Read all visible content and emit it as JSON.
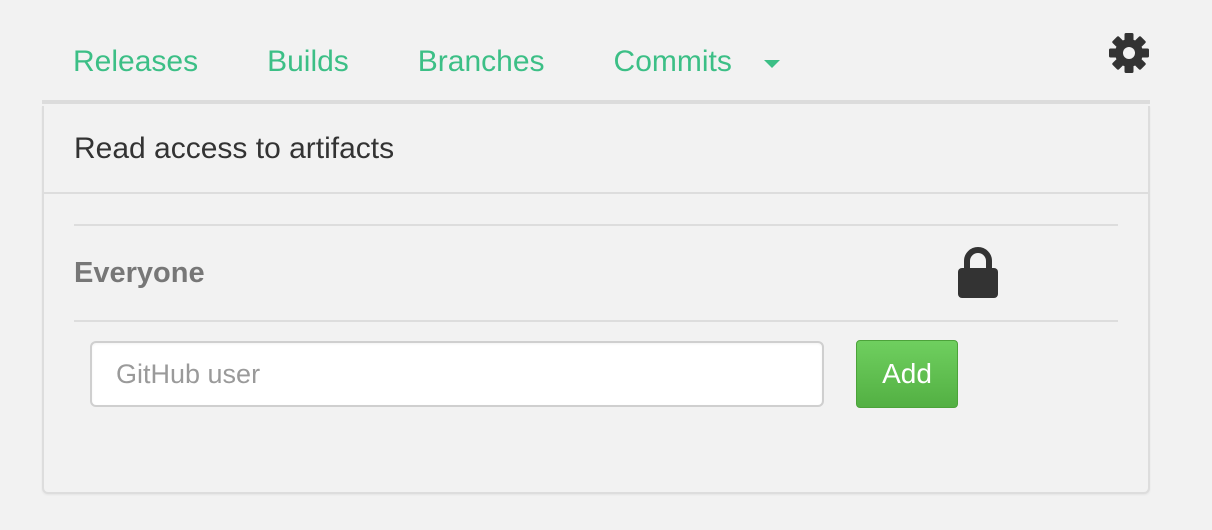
{
  "nav": {
    "tabs": [
      {
        "label": "Releases"
      },
      {
        "label": "Builds"
      },
      {
        "label": "Branches"
      },
      {
        "label": "Commits"
      }
    ],
    "tab_color": "#3cbf86",
    "dropdown_icon": "caret-down-icon",
    "settings_icon": "gear-icon"
  },
  "panel": {
    "title": "Read access to artifacts",
    "everyone_label": "Everyone",
    "lock_icon": "lock-icon",
    "user_input": {
      "value": "",
      "placeholder": "GitHub user"
    },
    "add_button_label": "Add",
    "add_button_color": "#5cb94a"
  }
}
